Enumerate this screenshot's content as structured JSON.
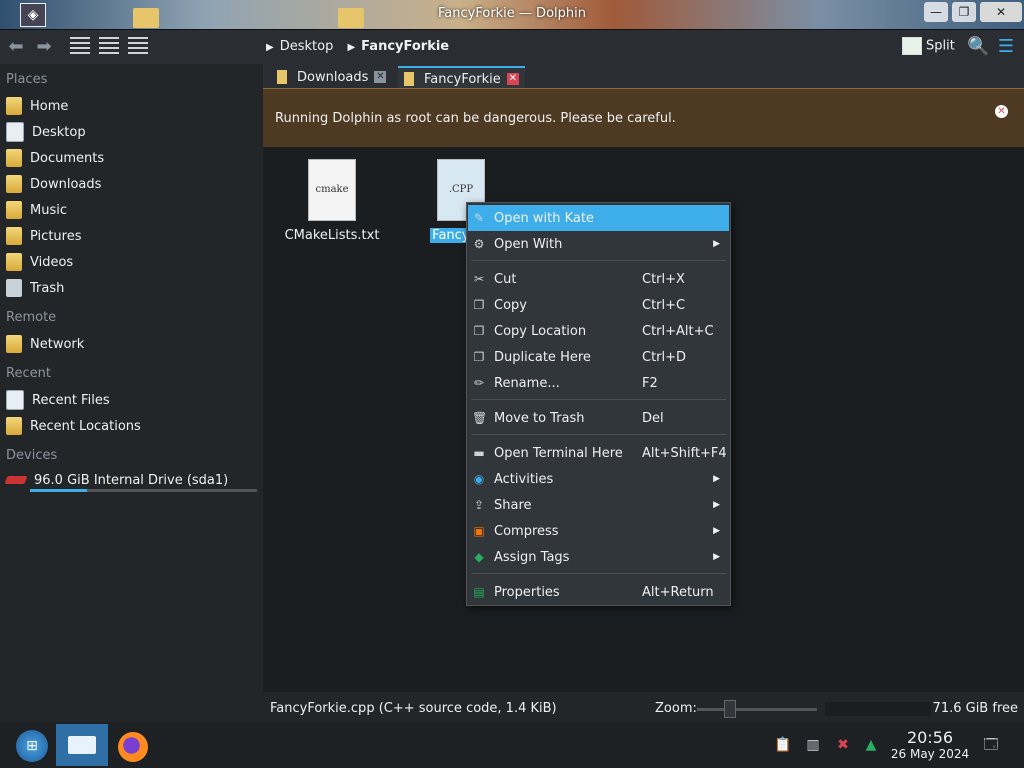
{
  "window": {
    "title": "FancyForkie — Dolphin"
  },
  "window_buttons": {
    "minimize": "—",
    "maximize": "❐",
    "close": "✕"
  },
  "toolbar": {
    "breadcrumb": [
      "Desktop",
      "FancyForkie"
    ],
    "split_label": "Split"
  },
  "sidebar": {
    "places_header": "Places",
    "places": [
      "Home",
      "Desktop",
      "Documents",
      "Downloads",
      "Music",
      "Pictures",
      "Videos",
      "Trash"
    ],
    "remote_header": "Remote",
    "remote": [
      "Network"
    ],
    "recent_header": "Recent",
    "recent": [
      "Recent Files",
      "Recent Locations"
    ],
    "devices_header": "Devices",
    "devices": [
      {
        "label": "96.0 GiB Internal Drive (sda1)",
        "used_fraction": 0.25
      }
    ]
  },
  "tabs": [
    {
      "label": "Downloads",
      "active": false
    },
    {
      "label": "FancyForkie",
      "active": true
    }
  ],
  "warning": {
    "message": "Running Dolphin as root can be dangerous. Please be careful."
  },
  "files": [
    {
      "name": "CMakeLists.txt",
      "thumb_text": "cmake",
      "selected": false
    },
    {
      "name": "FancyFor",
      "thumb_text": ".CPP",
      "selected": true
    }
  ],
  "context_menu": {
    "items": [
      {
        "label": "Open with Kate",
        "shortcut": "",
        "submenu": false,
        "highlighted": true,
        "icon": "kate-icon"
      },
      {
        "label": "Open With",
        "shortcut": "",
        "submenu": true,
        "icon": "open-with-icon"
      },
      {
        "label": "Cut",
        "shortcut": "Ctrl+X",
        "submenu": false,
        "icon": "scissors-icon"
      },
      {
        "label": "Copy",
        "shortcut": "Ctrl+C",
        "submenu": false,
        "icon": "copy-icon"
      },
      {
        "label": "Copy Location",
        "shortcut": "Ctrl+Alt+C",
        "submenu": false,
        "icon": "copy-location-icon"
      },
      {
        "label": "Duplicate Here",
        "shortcut": "Ctrl+D",
        "submenu": false,
        "icon": "duplicate-icon"
      },
      {
        "label": "Rename...",
        "shortcut": "F2",
        "submenu": false,
        "icon": "rename-icon"
      },
      {
        "label": "Move to Trash",
        "shortcut": "Del",
        "submenu": false,
        "icon": "trash-icon"
      },
      {
        "label": "Open Terminal Here",
        "shortcut": "Alt+Shift+F4",
        "submenu": false,
        "icon": "terminal-icon"
      },
      {
        "label": "Activities",
        "shortcut": "",
        "submenu": true,
        "icon": "activities-icon"
      },
      {
        "label": "Share",
        "shortcut": "",
        "submenu": true,
        "icon": "share-icon"
      },
      {
        "label": "Compress",
        "shortcut": "",
        "submenu": true,
        "icon": "compress-icon"
      },
      {
        "label": "Assign Tags",
        "shortcut": "",
        "submenu": true,
        "icon": "tag-icon"
      },
      {
        "label": "Properties",
        "shortcut": "Alt+Return",
        "submenu": false,
        "icon": "properties-icon"
      }
    ],
    "submenu_arrow": "▶"
  },
  "statusbar": {
    "info": "FancyForkie.cpp (C++ source code, 1.4 KiB)",
    "zoom_label": "Zoom:",
    "free": "71.6 GiB free"
  },
  "taskbar": {
    "time": "20:56",
    "date": "26 May 2024"
  },
  "colors": {
    "accent": "#3daee9",
    "warning_bg": "#4e3a22",
    "window_bg": "#232629",
    "view_bg": "#1b1e20"
  }
}
